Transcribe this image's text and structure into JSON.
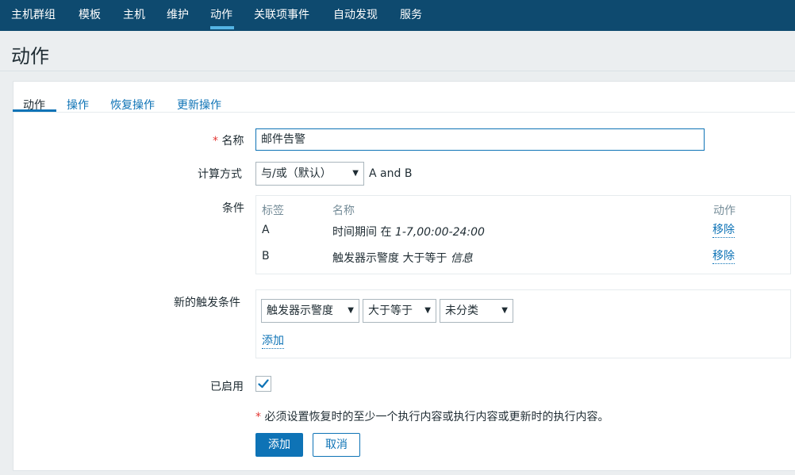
{
  "nav": {
    "items": [
      {
        "label": "主机群组"
      },
      {
        "label": "模板"
      },
      {
        "label": "主机"
      },
      {
        "label": "维护"
      },
      {
        "label": "动作",
        "active": true
      },
      {
        "label": "关联项事件"
      },
      {
        "label": "自动发现"
      },
      {
        "label": "服务"
      }
    ]
  },
  "page": {
    "title": "动作"
  },
  "tabs": [
    {
      "label": "动作",
      "active": true
    },
    {
      "label": "操作"
    },
    {
      "label": "恢复操作"
    },
    {
      "label": "更新操作"
    }
  ],
  "form": {
    "name_label": "名称",
    "name_value": "邮件告警",
    "calc_label": "计算方式",
    "calc_select": "与/或（默认）",
    "calc_expression": "A and B",
    "conditions_label": "条件",
    "conditions": {
      "headers": {
        "tag": "标签",
        "name": "名称",
        "action": "动作"
      },
      "rows": [
        {
          "tag": "A",
          "name_prefix": "时间期间 在 ",
          "name_value": "1-7,00:00-24:00",
          "action": "移除"
        },
        {
          "tag": "B",
          "name_prefix": "触发器示警度 大于等于 ",
          "name_value": "信息",
          "action": "移除"
        }
      ]
    },
    "new_condition_label": "新的触发条件",
    "new_condition": {
      "type_select": "触发器示警度",
      "operator_select": "大于等于",
      "value_select": "未分类",
      "add_link": "添加"
    },
    "enabled_label": "已启用",
    "enabled": true,
    "required_note": "必须设置恢复时的至少一个执行内容或执行内容或更新时的执行内容。",
    "add_button": "添加",
    "cancel_button": "取消"
  },
  "colors": {
    "nav_bg": "#0e4a6f",
    "accent": "#0e73b6",
    "required": "#e33734"
  }
}
